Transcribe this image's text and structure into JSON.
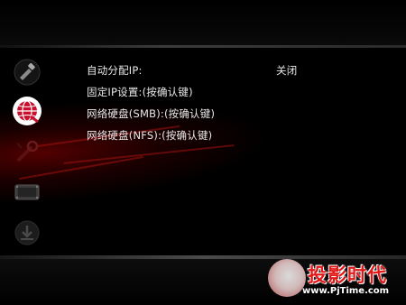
{
  "menu": {
    "items": [
      {
        "label": "自动分配IP:",
        "value": "关闭"
      },
      {
        "label": "固定IP设置:(按确认键)",
        "value": ""
      },
      {
        "label": "网络硬盘(SMB):(按确认键)",
        "value": ""
      },
      {
        "label": "网络硬盘(NFS):(按确认键)",
        "value": ""
      }
    ]
  },
  "sidebar": {
    "icons": [
      "tools-icon",
      "network-globe-icon",
      "wrench-icon",
      "film-icon",
      "download-icon"
    ],
    "active_index": 1
  },
  "watermark": {
    "title": "投影时代",
    "url": "www.PjTime.com"
  },
  "colors": {
    "background": "#000000",
    "accent_red": "#c8102e",
    "text": "#e8e8e8"
  }
}
